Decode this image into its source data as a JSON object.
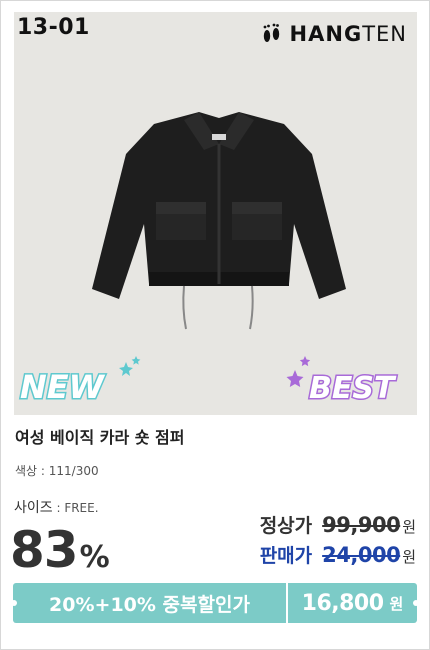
{
  "product": {
    "code": "13-01",
    "brand_bold": "HANG",
    "brand_thin": "TEN",
    "badge_new": "NEW",
    "badge_best": "BEST",
    "title": "여성 베이직 카라 숏 점퍼",
    "color_label": "색상",
    "color_value": " : 111/300",
    "size_label": "사이즈",
    "size_value": " : FREE."
  },
  "pricing": {
    "discount_number": "83",
    "discount_symbol": "%",
    "regular_label": "정상가",
    "regular_price": "99,900",
    "sale_label": "판매가",
    "sale_price": "24,000",
    "currency": "원"
  },
  "banner": {
    "promo_text": "20%+10% 중복할인가",
    "final_price": "16,800",
    "currency": "원"
  },
  "colors": {
    "banner": "#7ccbc7",
    "sale_blue": "#1f44a8",
    "new_badge": "#5ec9cf",
    "best_badge": "#a86ad8"
  }
}
